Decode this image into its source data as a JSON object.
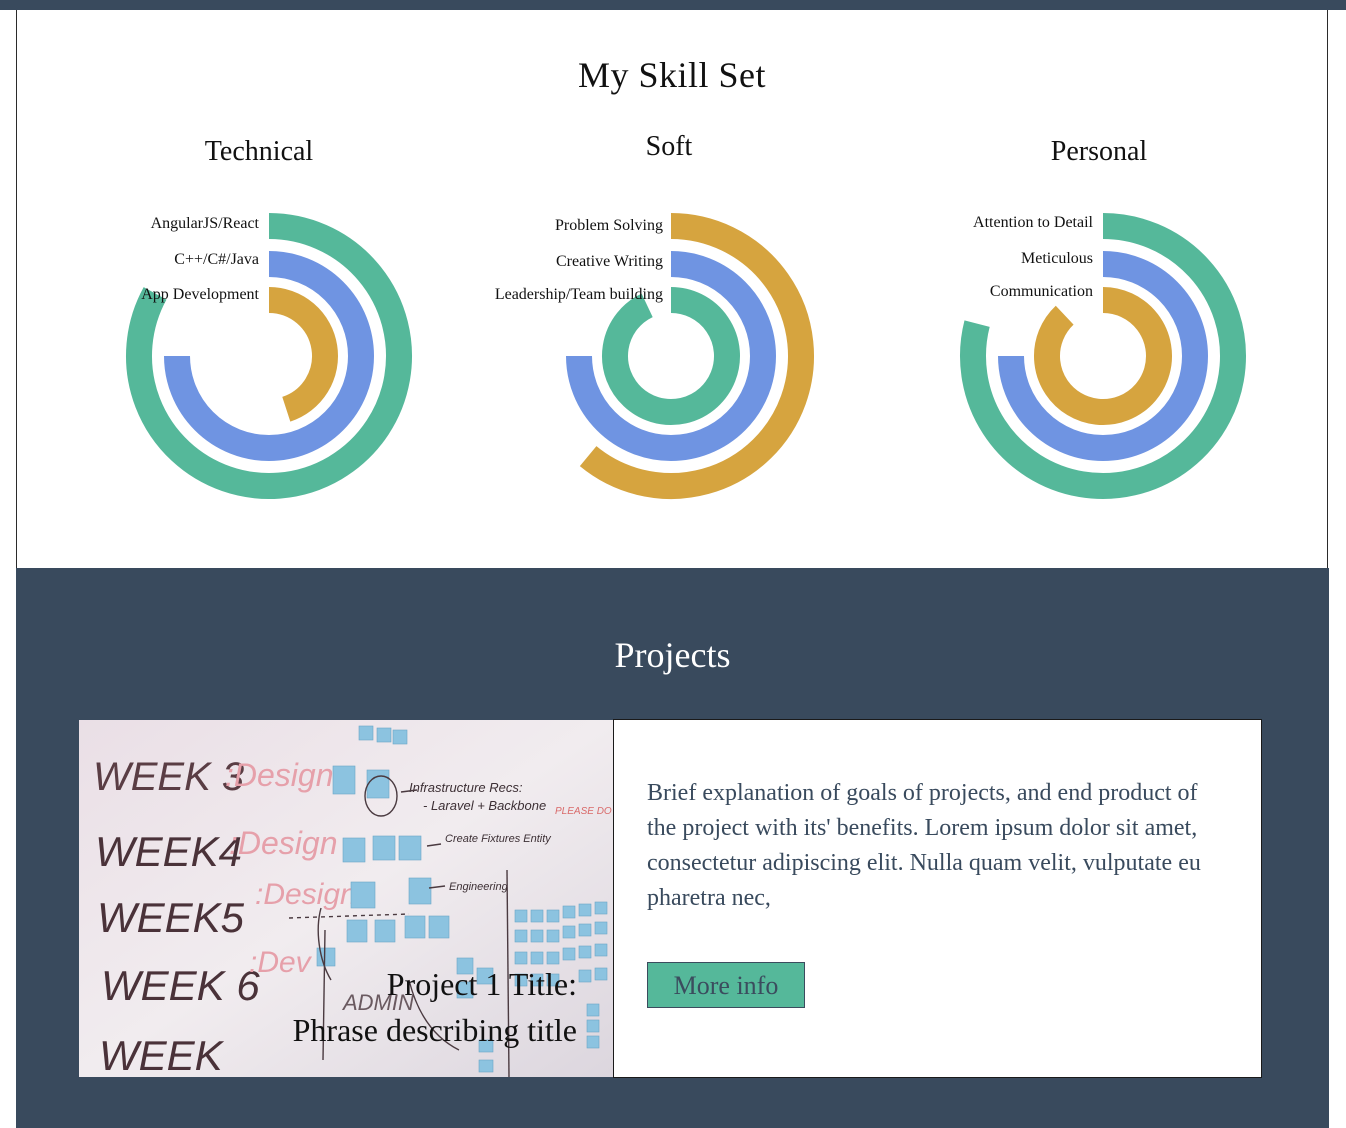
{
  "skills": {
    "title": "My Skill Set",
    "colors": {
      "green": "#55b89a",
      "blue": "#6f94e2",
      "gold": "#d6a43f"
    },
    "groups": [
      {
        "title": "Technical",
        "items": [
          {
            "label": "AngularJS/React",
            "fraction": 0.83,
            "color": "#55b89a"
          },
          {
            "label": "C++/C#/Java",
            "fraction": 0.75,
            "color": "#6f94e2"
          },
          {
            "label": "App Development",
            "fraction": 0.45,
            "color": "#d6a43f"
          }
        ]
      },
      {
        "title": "Soft",
        "items": [
          {
            "label": "Problem Solving",
            "fraction": 0.61,
            "color": "#d6a43f"
          },
          {
            "label": "Creative Writing",
            "fraction": 0.75,
            "color": "#6f94e2"
          },
          {
            "label": "Leadership/Team building",
            "fraction": 0.93,
            "color": "#55b89a"
          }
        ]
      },
      {
        "title": "Personal",
        "items": [
          {
            "label": "Attention to Detail",
            "fraction": 0.79,
            "color": "#55b89a"
          },
          {
            "label": "Meticulous",
            "fraction": 0.75,
            "color": "#6f94e2"
          },
          {
            "label": "Communication",
            "fraction": 0.88,
            "color": "#d6a43f"
          }
        ]
      }
    ]
  },
  "projects": {
    "title": "Projects",
    "items": [
      {
        "image_title_line1": "Project 1 Title:",
        "image_title_line2": "Phrase describing title",
        "description": "Brief explanation of goals of projects, and end product of the project with its' benefits. Lorem ipsum dolor sit amet, consectetur adipiscing elit. Nulla quam velit, vulputate eu pharetra nec,",
        "button_label": "More info",
        "button_color": "#55b89a",
        "whiteboard_text": {
          "week3": "WEEK 3",
          "design3": ":Design",
          "week4": "WEEK4",
          "design4": ":Design",
          "week5": "WEEK5",
          "design5": ":Design",
          "week6": "WEEK 6",
          "dev6": ":Dev",
          "week7": "WEEK",
          "note1": "Infrastructure Recs:",
          "note2": "- Laravel + Backbone",
          "note3": "Create Fixtures Entity",
          "note4": "Engineering",
          "note5": "ADMIN",
          "note6": "PLEASE DO NOT ERASE"
        }
      }
    ]
  }
}
